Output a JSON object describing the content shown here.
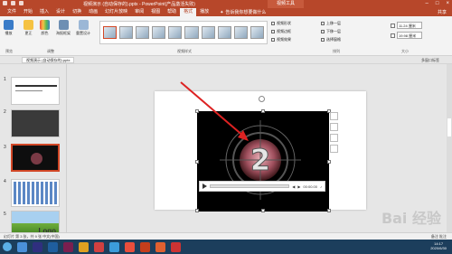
{
  "titlebar": {
    "title": "视频演示 (自动保存的).pptx - PowerPoint(产品激活失败)",
    "tools_tab": "视频工具"
  },
  "tabs": [
    {
      "label": "文件"
    },
    {
      "label": "开始"
    },
    {
      "label": "插入"
    },
    {
      "label": "设计"
    },
    {
      "label": "切换"
    },
    {
      "label": "动画"
    },
    {
      "label": "幻灯片放映"
    },
    {
      "label": "审阅"
    },
    {
      "label": "视图"
    },
    {
      "label": "帮助"
    },
    {
      "label": "格式"
    },
    {
      "label": "播放"
    }
  ],
  "tell_me": "告诉我你想要做什么",
  "share": "共享",
  "ribbon": {
    "buttons": [
      {
        "label": "播放"
      },
      {
        "label": "更正"
      },
      {
        "label": "颜色"
      },
      {
        "label": "海报框架"
      },
      {
        "label": "重置设计"
      }
    ],
    "group_preview": "预览",
    "group_adjust": "调整",
    "group_styles": "视频样式",
    "group_arrange": "排列",
    "group_size": "大小",
    "options": [
      "视频形状",
      "视频边框",
      "视频效果"
    ],
    "arrange": [
      "上移一层",
      "下移一层",
      "选择窗格"
    ],
    "size": {
      "height": "11.24 厘米",
      "width": "19.98 厘米"
    }
  },
  "qbar": {
    "doc_tab": "视频演示 (自动保存的).pptx",
    "right": "多窗口标签"
  },
  "slides": [
    {
      "num": "1"
    },
    {
      "num": "2"
    },
    {
      "num": "3"
    },
    {
      "num": "4"
    },
    {
      "num": "5"
    }
  ],
  "logo_text": "Logo",
  "video": {
    "countdown_digit": "2",
    "time": "00:00.00"
  },
  "status": {
    "left": "幻灯片 第 3 张，共 9 张    中文(中国)",
    "right": "备注   批注"
  },
  "taskbar": {
    "time": "14:17",
    "date": "2020/6/30"
  },
  "watermark": "Bai 经验"
}
